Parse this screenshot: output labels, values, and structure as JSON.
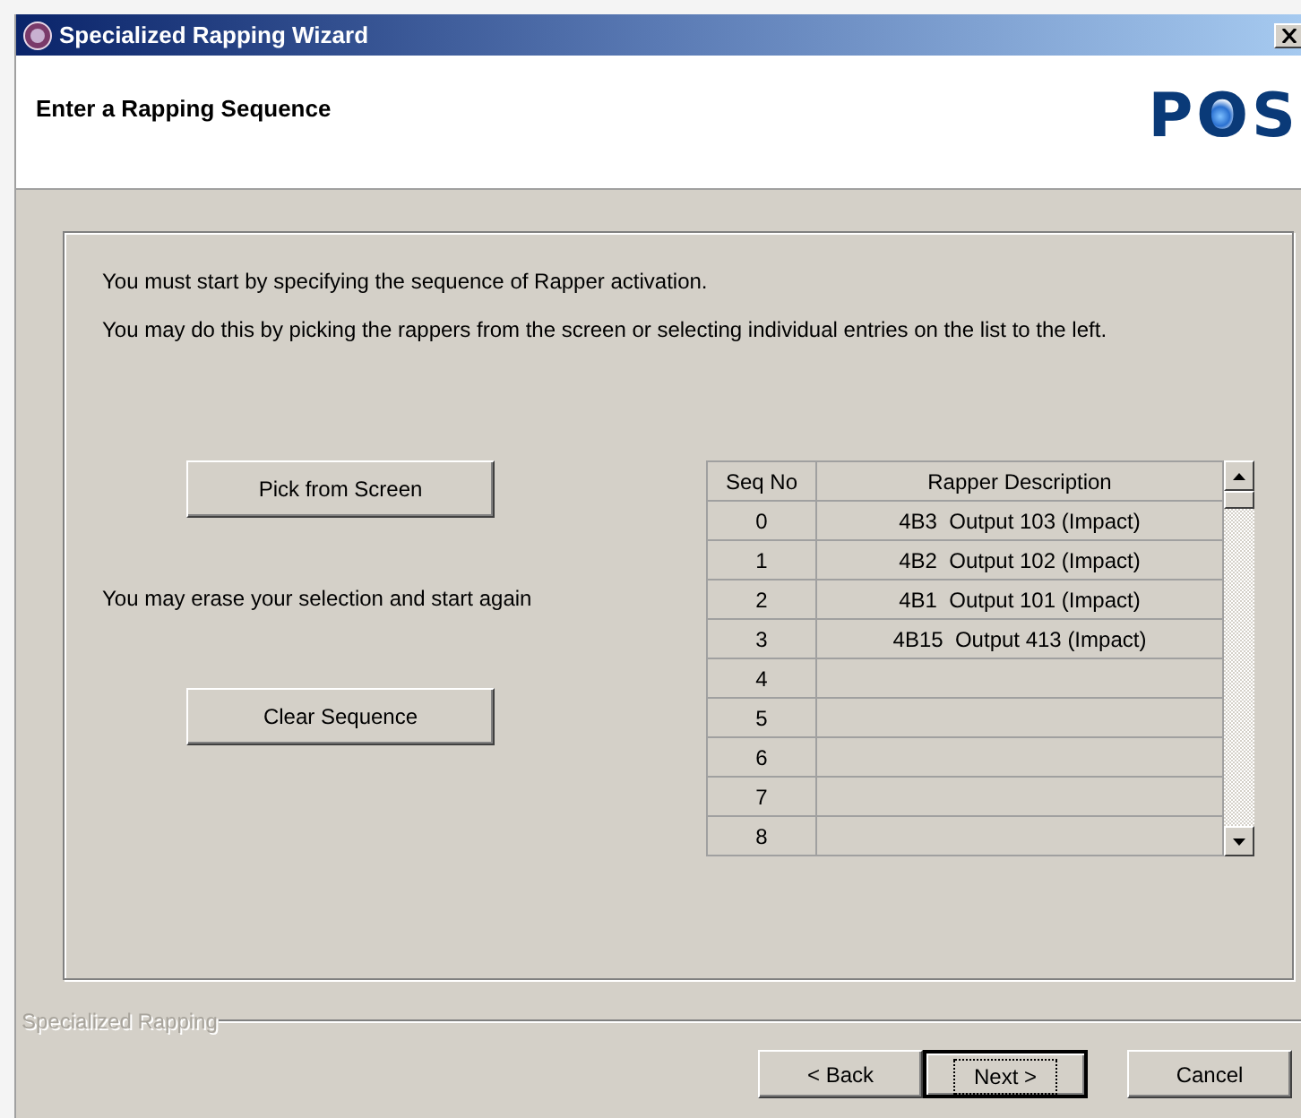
{
  "window": {
    "title": "Specialized Rapping Wizard"
  },
  "header": {
    "title": "Enter a Rapping Sequence",
    "logo_text": "POS"
  },
  "instructions": [
    "You must start by specifying the sequence of Rapper activation.",
    "You may do this by picking the rappers from the screen or selecting individual entries on the list to the left."
  ],
  "pick_button": "Pick from Screen",
  "erase_hint": "You may erase your selection and start again",
  "clear_button": "Clear Sequence",
  "table": {
    "columns": [
      "Seq No",
      "Rapper Description"
    ],
    "rows": [
      {
        "seq": "0",
        "description": "4B3  Output 103 (Impact)"
      },
      {
        "seq": "1",
        "description": "4B2  Output 102 (Impact)"
      },
      {
        "seq": "2",
        "description": "4B1  Output 101 (Impact)"
      },
      {
        "seq": "3",
        "description": "4B15  Output 413 (Impact)"
      },
      {
        "seq": "4",
        "description": ""
      },
      {
        "seq": "5",
        "description": ""
      },
      {
        "seq": "6",
        "description": ""
      },
      {
        "seq": "7",
        "description": ""
      },
      {
        "seq": "8",
        "description": ""
      }
    ]
  },
  "footer": {
    "group_label": "Specialized Rapping",
    "buttons": [
      {
        "label": "< Back",
        "focused": false
      },
      {
        "label": "Next >",
        "focused": true
      },
      {
        "label": "Cancel",
        "focused": false
      }
    ]
  }
}
